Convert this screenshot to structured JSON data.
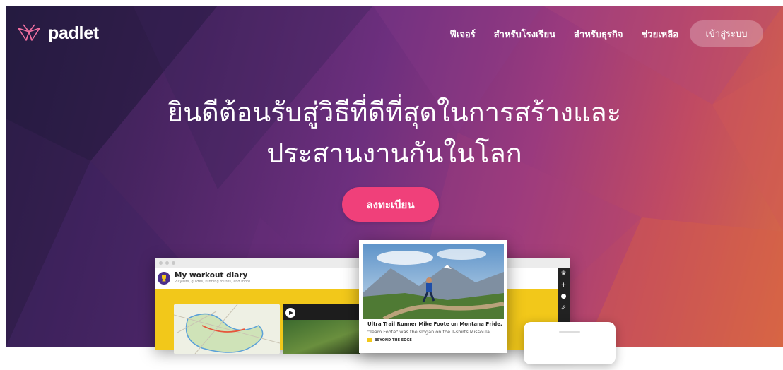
{
  "brand": {
    "name": "padlet",
    "accent": "#f0407a"
  },
  "nav": {
    "items": [
      "ฟีเจอร์",
      "สำหรับโรงเรียน",
      "สำหรับธุรกิจ",
      "ช่วยเหลือ"
    ],
    "login_label": "เข้าสู่ระบบ"
  },
  "hero": {
    "headline_line1": "ยินดีต้อนรับสู่วิธีที่ดีที่สุดในการสร้างและ",
    "headline_line2": "ประสานงานกันในโลก",
    "signup_label": "ลงทะเบียน"
  },
  "preview": {
    "board_title": "My workout diary",
    "board_subtitle": "Playlists, guides, running routes, and more.",
    "post_title": "Ultra Trail Runner Mike Foote on Montana Pride, Yurt ...",
    "post_body": "\"Team Foote\" was the slogan on the T-shirts Missoula, ...",
    "post_source": "BEYOND THE EDGE"
  }
}
